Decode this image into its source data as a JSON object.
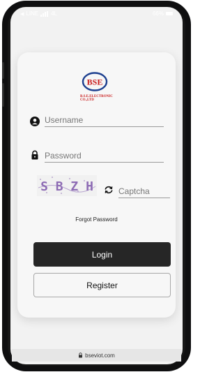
{
  "status_bar": {
    "carrier": "LINE",
    "network": "4L",
    "battery": "66%"
  },
  "logo": {
    "brand": "BSE",
    "company": "B.S.E.ELECTRONIC CO.,LTD"
  },
  "form": {
    "username_placeholder": "Username",
    "password_placeholder": "Password",
    "captcha_image_text": "S B Z H",
    "captcha_placeholder": "Captcha",
    "forgot_password": "Forgot Password",
    "login_label": "Login",
    "register_label": "Register"
  },
  "url_bar": {
    "url": "bseviot.com"
  },
  "colors": {
    "logo_red": "#c91b1b",
    "logo_blue": "#1d3f8f",
    "login_bg": "#262626",
    "captcha_purple": "#8d6bb4"
  }
}
